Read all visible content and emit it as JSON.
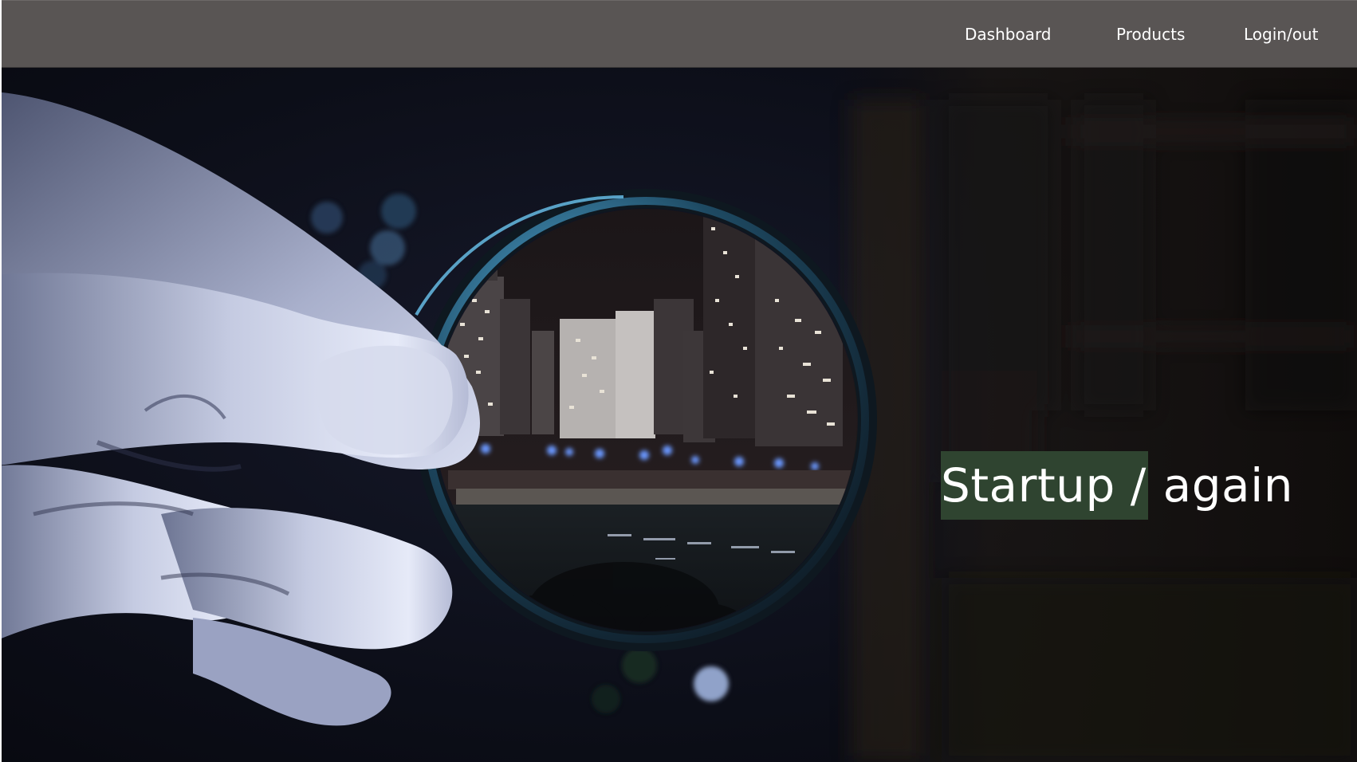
{
  "nav": {
    "dashboard_label": "Dashboard",
    "products_label": "Products",
    "auth_label": "Login/out"
  },
  "hero": {
    "headline_highlight": "Startup /",
    "headline_rest": " again",
    "image_description": "Hand holding a lens filter that frames a night city skyline by the beach",
    "highlight_color": "#2f4430",
    "nav_background_color": "#595554"
  }
}
